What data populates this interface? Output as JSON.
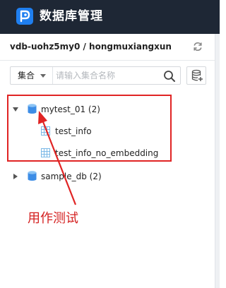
{
  "header": {
    "title": "数据库管理",
    "logo_icon": "database-logo-icon"
  },
  "instance": {
    "name": "vdb-uohz5my0 / hongmuxiangxun",
    "refresh_icon": "refresh-icon"
  },
  "search": {
    "type_selected": "集合",
    "placeholder": "请输入集合名称",
    "search_icon": "search-icon",
    "add_icon": "add-collection-icon"
  },
  "tree": {
    "databases": [
      {
        "label": "mytest_01 (2)",
        "expanded": true,
        "collections": [
          {
            "label": "test_info"
          },
          {
            "label": "test_info_no_embedding"
          }
        ]
      },
      {
        "label": "sample_db (2)",
        "expanded": false,
        "collections": []
      }
    ]
  },
  "annotation": {
    "text": "用作测试",
    "color": "#e02424"
  },
  "colors": {
    "header_bg": "#1e2735",
    "accent_blue": "#1f7ff0",
    "table_icon": "#7bb8e6"
  }
}
